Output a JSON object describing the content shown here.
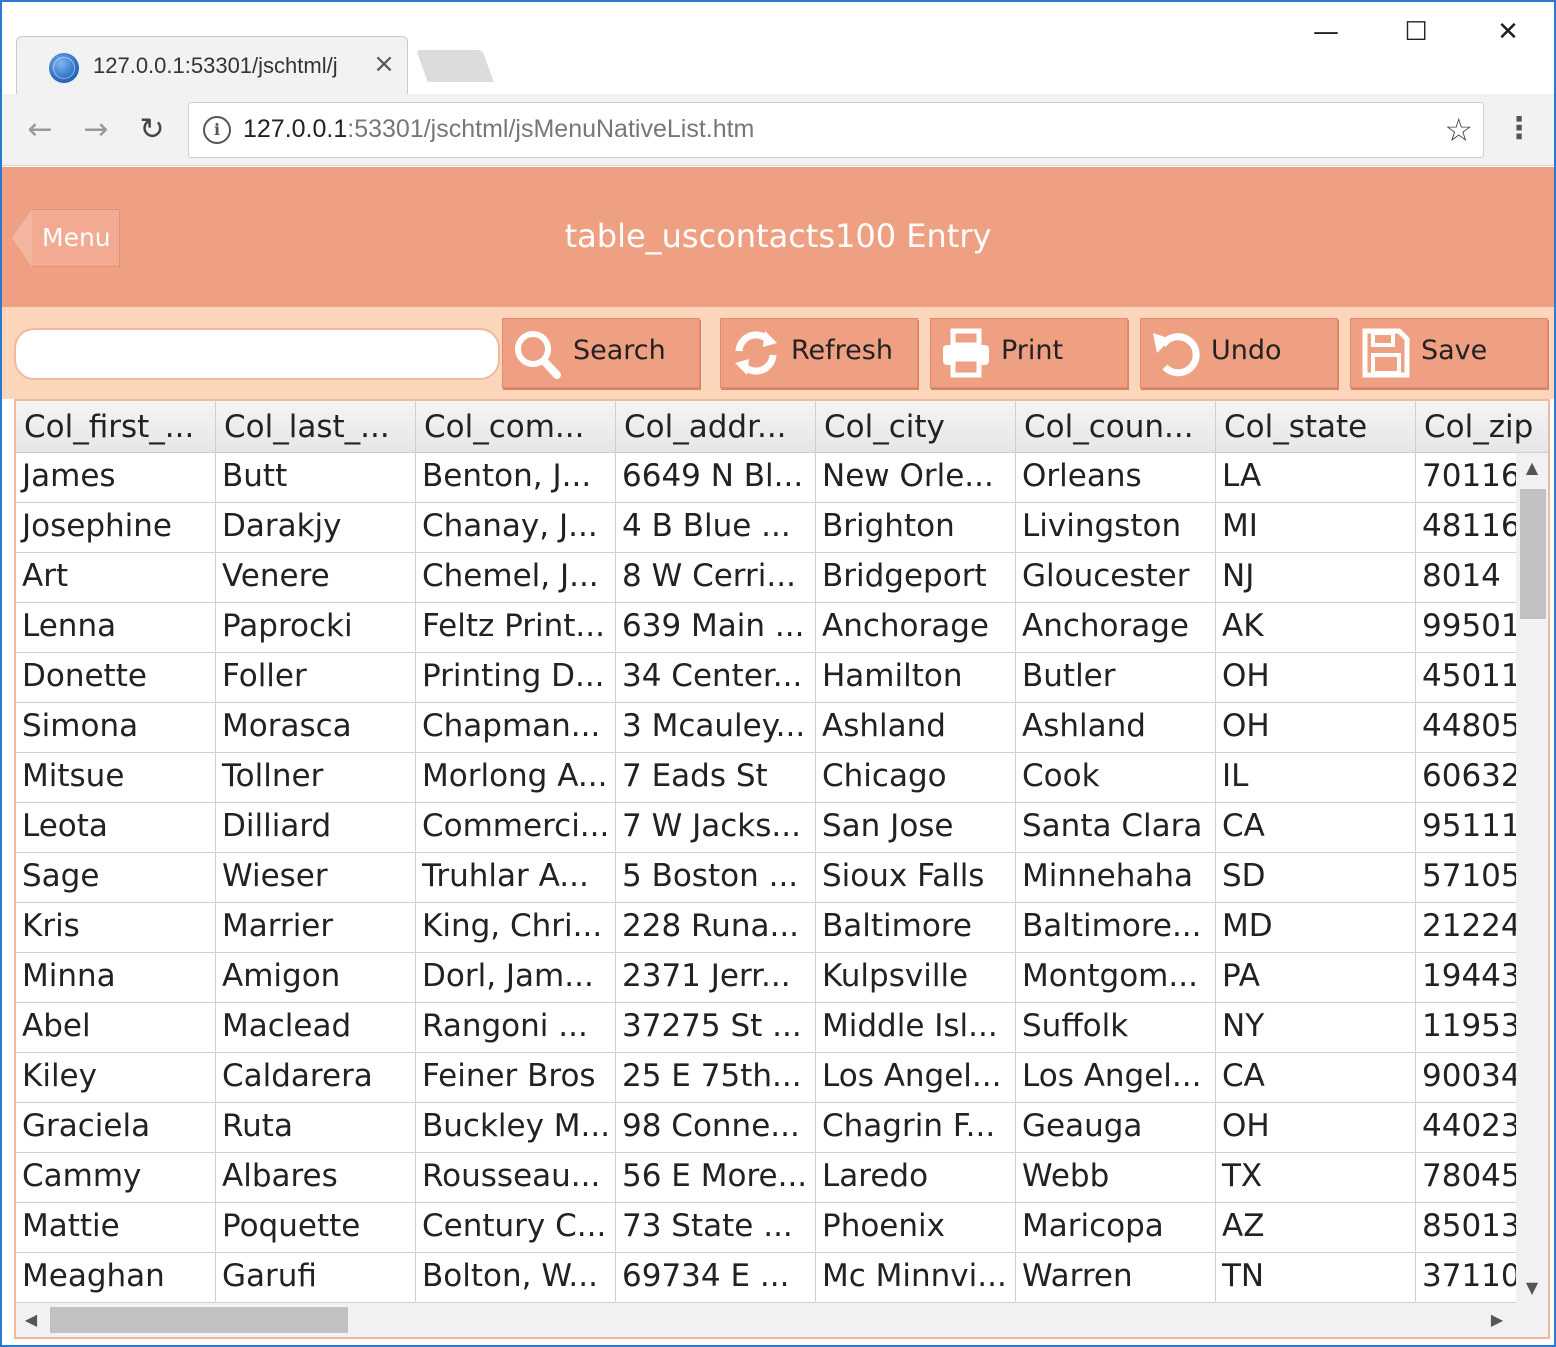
{
  "browser": {
    "tab_title": "127.0.0.1:53301/jschtml/j",
    "tab_close": "×",
    "url_host": "127.0.0.1",
    "url_rest": ":53301/jschtml/jsMenuNativeList.htm",
    "minimize": "—",
    "maximize": "☐",
    "close": "✕",
    "back": "←",
    "forward": "→",
    "reload": "↻",
    "info": "i",
    "star": "☆",
    "menu": "⋮"
  },
  "header": {
    "menu_label": "Menu",
    "title": "table_uscontacts100 Entry"
  },
  "actions": {
    "search_placeholder": "",
    "search_label": "Search",
    "refresh_label": "Refresh",
    "print_label": "Print",
    "undo_label": "Undo",
    "save_label": "Save"
  },
  "colors": {
    "header_bg": "#ef9f82",
    "actionbar_bg": "#fcd6bb",
    "button_bg": "#ef9f82"
  },
  "grid": {
    "columns": [
      "Col_first_...",
      "Col_last_...",
      "Col_com...",
      "Col_addr...",
      "Col_city",
      "Col_coun...",
      "Col_state",
      "Col_zip"
    ],
    "rows": [
      [
        "James",
        "Butt",
        "Benton, J...",
        "6649 N Bl...",
        "New Orle...",
        "Orleans",
        "LA",
        "70116"
      ],
      [
        "Josephine",
        "Darakjy",
        "Chanay, J...",
        "4 B Blue ...",
        "Brighton",
        "Livingston",
        "MI",
        "48116"
      ],
      [
        "Art",
        "Venere",
        "Chemel, J...",
        "8 W Cerri...",
        "Bridgeport",
        "Gloucester",
        "NJ",
        "8014"
      ],
      [
        "Lenna",
        "Paprocki",
        "Feltz Print...",
        "639 Main ...",
        "Anchorage",
        "Anchorage",
        "AK",
        "99501"
      ],
      [
        "Donette",
        "Foller",
        "Printing D...",
        "34 Center...",
        "Hamilton",
        "Butler",
        "OH",
        "45011"
      ],
      [
        "Simona",
        "Morasca",
        "Chapman...",
        "3 Mcauley...",
        "Ashland",
        "Ashland",
        "OH",
        "44805"
      ],
      [
        "Mitsue",
        "Tollner",
        "Morlong A...",
        "7 Eads St",
        "Chicago",
        "Cook",
        "IL",
        "60632"
      ],
      [
        "Leota",
        "Dilliard",
        "Commerci...",
        "7 W Jacks...",
        "San Jose",
        "Santa Clara",
        "CA",
        "95111"
      ],
      [
        "Sage",
        "Wieser",
        "Truhlar A...",
        "5 Boston ...",
        "Sioux Falls",
        "Minnehaha",
        "SD",
        "57105"
      ],
      [
        "Kris",
        "Marrier",
        "King, Chri...",
        "228 Runa...",
        "Baltimore",
        "Baltimore...",
        "MD",
        "21224"
      ],
      [
        "Minna",
        "Amigon",
        "Dorl, Jam...",
        "2371 Jerr...",
        "Kulpsville",
        "Montgom...",
        "PA",
        "19443"
      ],
      [
        "Abel",
        "Maclead",
        "Rangoni ...",
        "37275 St ...",
        "Middle Isl...",
        "Suffolk",
        "NY",
        "11953"
      ],
      [
        "Kiley",
        "Caldarera",
        "Feiner Bros",
        "25 E 75th...",
        "Los Angel...",
        "Los Angel...",
        "CA",
        "90034"
      ],
      [
        "Graciela",
        "Ruta",
        "Buckley M...",
        "98 Conne...",
        "Chagrin F...",
        "Geauga",
        "OH",
        "44023"
      ],
      [
        "Cammy",
        "Albares",
        "Rousseau...",
        "56 E More...",
        "Laredo",
        "Webb",
        "TX",
        "78045"
      ],
      [
        "Mattie",
        "Poquette",
        "Century C...",
        "73 State ...",
        "Phoenix",
        "Maricopa",
        "AZ",
        "85013"
      ],
      [
        "Meaghan",
        "Garufi",
        "Bolton, W...",
        "69734 E ...",
        "Mc Minnvi...",
        "Warren",
        "TN",
        "37110"
      ]
    ]
  },
  "scroll": {
    "up": "▲",
    "down": "▼",
    "left": "◀",
    "right": "▶"
  }
}
